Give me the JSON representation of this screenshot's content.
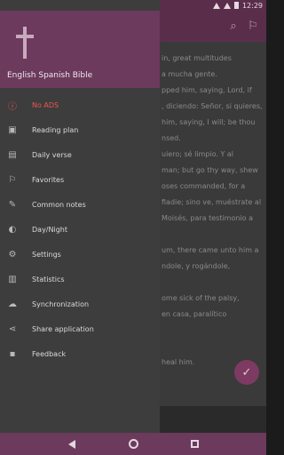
{
  "status_bar": {
    "time": "12:29"
  },
  "drawer": {
    "title": "English Spanish Bible",
    "items": [
      {
        "label": "No ADS",
        "icon": "info-icon",
        "glyph": "ⓘ",
        "active": true
      },
      {
        "label": "Reading plan",
        "icon": "calendar-icon",
        "glyph": "▣",
        "active": false
      },
      {
        "label": "Daily verse",
        "icon": "newspaper-icon",
        "glyph": "▤",
        "active": false
      },
      {
        "label": "Favorites",
        "icon": "bookmark-icon",
        "glyph": "⚐",
        "active": false
      },
      {
        "label": "Common notes",
        "icon": "edit-note-icon",
        "glyph": "✎",
        "active": false
      },
      {
        "label": "Day/Night",
        "icon": "brightness-icon",
        "glyph": "◐",
        "active": false
      },
      {
        "label": "Settings",
        "icon": "gear-icon",
        "glyph": "⚙",
        "active": false
      },
      {
        "label": "Statistics",
        "icon": "bar-chart-icon",
        "glyph": "▥",
        "active": false
      },
      {
        "label": "Synchronization",
        "icon": "cloud-sync-icon",
        "glyph": "☁",
        "active": false
      },
      {
        "label": "Share application",
        "icon": "share-icon",
        "glyph": "⋖",
        "active": false
      },
      {
        "label": "Feedback",
        "icon": "feedback-icon",
        "glyph": "▪",
        "active": false
      }
    ]
  },
  "background_text": {
    "lines": [
      "in, great multitudes",
      "a mucha gente.",
      "pped him, saying, Lord, if",
      ", diciendo: Señor, si quieres,",
      "him, saying, I will; be thou",
      "nsed.",
      "uiero; sé limpio. Y al",
      "man; but go thy way, shew",
      "oses commanded, for a",
      "fiadie; sino ve, muéstrate al",
      "Moisés, para testimonio a",
      "",
      "um, there came unto him a",
      "ndole, y rogándole,",
      "",
      "ome sick of the palsy,",
      "en casa, paralítico",
      "",
      "",
      "heal him."
    ]
  }
}
